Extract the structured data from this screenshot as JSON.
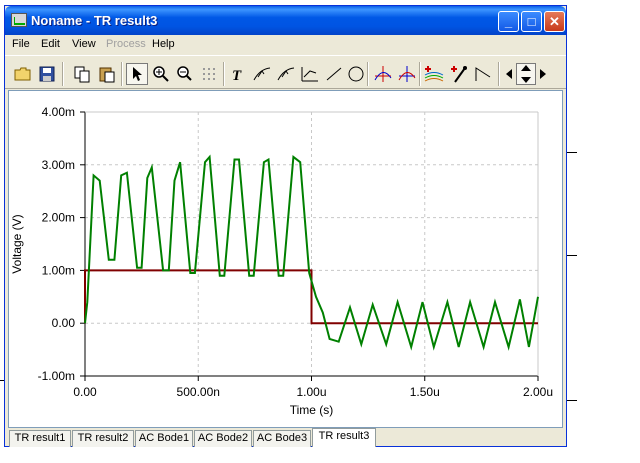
{
  "window": {
    "title": "Noname - TR result3",
    "min_label": "_",
    "max_label": "□",
    "close_label": "✕"
  },
  "menu": {
    "items": [
      {
        "label": "File",
        "enabled": true
      },
      {
        "label": "Edit",
        "enabled": true
      },
      {
        "label": "View",
        "enabled": true
      },
      {
        "label": "Process",
        "enabled": false
      },
      {
        "label": "Help",
        "enabled": true
      }
    ]
  },
  "toolbar": {
    "tools": [
      "open-icon",
      "save-icon",
      "copy-icon",
      "paste-icon",
      "pointer-icon",
      "zoom-in-icon",
      "zoom-100-icon",
      "grid-icon",
      "text-icon",
      "cursor-a-icon",
      "cursor-b-icon",
      "axis-icon",
      "line-icon",
      "circle-icon",
      "marker-a-icon",
      "marker-b-icon",
      "curves-icon",
      "probe-icon",
      "step-icon",
      "scroll-left-icon",
      "scroll-updown-icon",
      "scroll-right-icon"
    ]
  },
  "tabs": [
    {
      "label": "TR result1",
      "active": false
    },
    {
      "label": "TR result2",
      "active": false
    },
    {
      "label": "AC Bode1",
      "active": false
    },
    {
      "label": "AC Bode2",
      "active": false
    },
    {
      "label": "AC Bode3",
      "active": false
    },
    {
      "label": "TR result3",
      "active": true
    }
  ],
  "chart_data": {
    "type": "line",
    "xlabel": "Time (s)",
    "ylabel": "Voltage (V)",
    "xlim": [
      0,
      2e-06
    ],
    "ylim": [
      -0.001,
      0.004
    ],
    "x_tick_labels": [
      "0.00",
      "500.00n",
      "1.00u",
      "1.50u",
      "2.00u"
    ],
    "x_ticks": [
      0,
      5e-07,
      1e-06,
      1.5e-06,
      2e-06
    ],
    "y_tick_labels": [
      "4.00m",
      "3.00m",
      "2.00m",
      "1.00m",
      "0.00",
      "-1.00m"
    ],
    "y_ticks": [
      0.004,
      0.003,
      0.002,
      0.001,
      0,
      -0.001
    ],
    "grid": true,
    "series": [
      {
        "color": "#800000",
        "x": [
          0,
          0,
          1e-06,
          1e-06,
          2e-06
        ],
        "y": [
          0,
          0.001,
          0.001,
          0,
          0
        ]
      },
      {
        "color": "#008000",
        "x": [
          0,
          1e-08,
          3.8e-08,
          6.5e-08,
          1.05e-07,
          1.3e-07,
          1.6e-07,
          1.85e-07,
          2.3e-07,
          2.5e-07,
          2.75e-07,
          2.95e-07,
          3.45e-07,
          3.7e-07,
          3.95e-07,
          4.2e-07,
          4.65e-07,
          4.85e-07,
          5.3e-07,
          5.5e-07,
          5.95e-07,
          6.15e-07,
          6.6e-07,
          6.8e-07,
          7.25e-07,
          7.45e-07,
          7.9e-07,
          8.1e-07,
          8.55e-07,
          8.75e-07,
          9.2e-07,
          9.5e-07,
          9.9e-07,
          1.02e-06,
          1.05e-06,
          1.08e-06,
          1.12e-06,
          1.17e-06,
          1.22e-06,
          1.27e-06,
          1.33e-06,
          1.38e-06,
          1.44e-06,
          1.49e-06,
          1.54e-06,
          1.6e-06,
          1.65e-06,
          1.7e-06,
          1.76e-06,
          1.81e-06,
          1.87e-06,
          1.92e-06,
          1.96e-06,
          2e-06
        ],
        "y": [
          0,
          0.0004,
          0.0028,
          0.0027,
          0.0012,
          0.0012,
          0.0028,
          0.00285,
          0.00105,
          0.00105,
          0.00275,
          0.00295,
          0.001,
          0.001,
          0.0027,
          0.00305,
          0.00095,
          0.00095,
          0.00305,
          0.00315,
          0.0009,
          0.0009,
          0.0031,
          0.0031,
          0.0009,
          0.0009,
          0.00305,
          0.0031,
          0.0009,
          0.0009,
          0.00315,
          0.00305,
          0.00095,
          0.0005,
          0.0002,
          -0.0003,
          -0.00035,
          0.0003,
          -0.0004,
          0.00035,
          -0.0004,
          0.0004,
          -0.00045,
          0.0004,
          -0.00045,
          0.0004,
          -0.00045,
          0.0004,
          -0.00045,
          0.0004,
          -0.00045,
          0.00045,
          -0.00045,
          0.0005
        ]
      }
    ]
  }
}
